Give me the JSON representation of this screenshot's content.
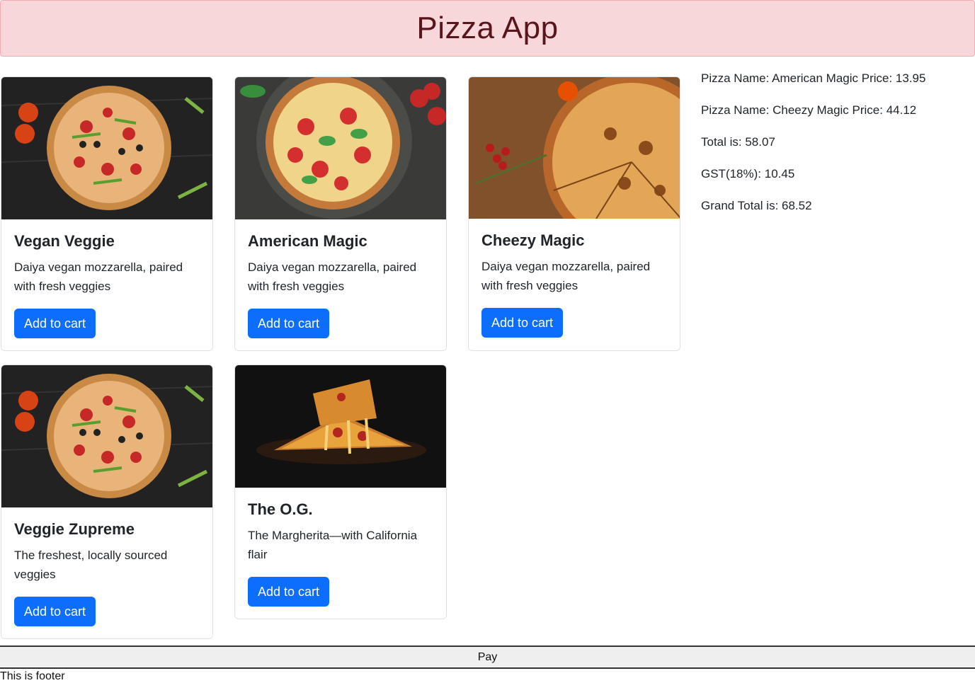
{
  "app": {
    "title": "Pizza App"
  },
  "pizzas": [
    {
      "name": "Vegan Veggie",
      "description": "Daiya vegan mozzarella, paired with fresh veggies",
      "button": "Add to cart"
    },
    {
      "name": "American Magic",
      "description": "Daiya vegan mozzarella, paired with fresh veggies",
      "button": "Add to cart"
    },
    {
      "name": "Cheezy Magic",
      "description": "Daiya vegan mozzarella, paired with fresh veggies",
      "button": "Add to cart"
    },
    {
      "name": "Veggie Zupreme",
      "description": "The freshest, locally sourced veggies",
      "button": "Add to cart"
    },
    {
      "name": "The O.G.",
      "description": "The Margherita—with California flair",
      "button": "Add to cart"
    }
  ],
  "cart": {
    "items": [
      "Pizza Name: American Magic Price: 13.95",
      "Pizza Name: Cheezy Magic Price: 44.12"
    ],
    "total": "Total is: 58.07",
    "gst": "GST(18%): 10.45",
    "grand_total": "Grand Total is: 68.52"
  },
  "pay_label": "Pay",
  "footer": "This is footer",
  "colors": {
    "header_bg": "#f8d7da",
    "header_text": "#58151c",
    "button": "#0d6efd"
  }
}
